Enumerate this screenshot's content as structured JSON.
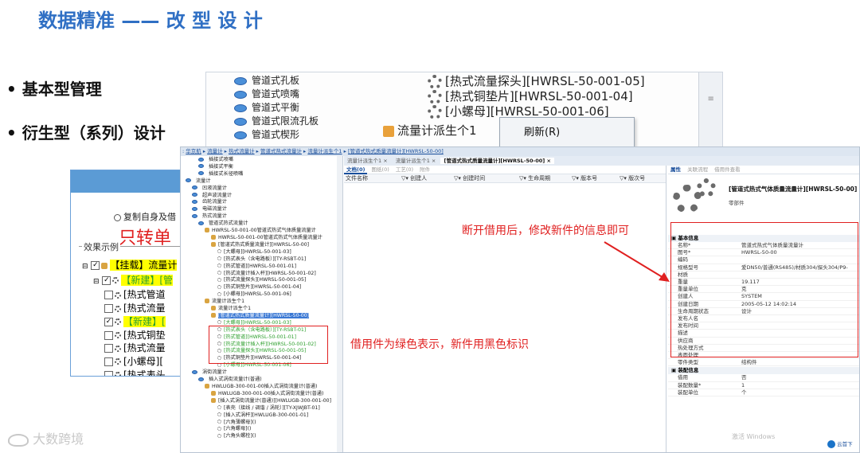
{
  "slide": {
    "title": "数据精准 —— 改 型 设 计",
    "bullets": [
      "基本型管理",
      "衍生型（系列）设计"
    ],
    "note_disconnect": "断开借用后，修改新件的信息即可",
    "note_color": "借用件为绿色表示，新件用黑色标识",
    "watermark": "大数跨境",
    "colors": {
      "title": "#2f6fc4",
      "accent_red": "#e02020",
      "green": "#2ea02e"
    }
  },
  "back_window": {
    "left_items": [
      "管道式孔板",
      "管道式喷嘴",
      "管道式平衡",
      "管道式限流孔板",
      "管道式楔形"
    ],
    "right_items": [
      "[热式流量探头][HWRSL-50-001-05]",
      "[热式铜垫片][HWRSL-50-001-04]",
      "[小螺母][HWRSL-50-001-06]"
    ],
    "derive_node": "流量计派生个1",
    "context_menu": "刷新(R)"
  },
  "dialog": {
    "radio_label": "复制自身及借",
    "big_label": "只转单",
    "group_title": "效果示例",
    "rows": [
      {
        "text": "【挂载】流量计",
        "hl": "yellow"
      },
      {
        "text": "【新建】[管",
        "hl": "yellow",
        "green_text": true
      },
      {
        "text": "[热式管道",
        "hl": ""
      },
      {
        "text": "[热式流量",
        "hl": ""
      },
      {
        "text": "【新建】[",
        "hl": "yellow",
        "green_text": true
      },
      {
        "text": "[热式铜垫",
        "hl": ""
      },
      {
        "text": "[热式流量",
        "hl": ""
      },
      {
        "text": "[小螺母][",
        "hl": ""
      },
      {
        "text": "[热式表头",
        "hl": ""
      }
    ]
  },
  "main_window": {
    "breadcrumb": [
      "华京航",
      "流量计",
      "热式流量计",
      "管道式热式流量计",
      "流量计派生个1",
      "[管道式热式质量流量计][HWRSL-50-00]"
    ],
    "tree": [
      {
        "t": "插接式喷嘴",
        "lv": 2
      },
      {
        "t": "插接式平衡",
        "lv": 2
      },
      {
        "t": "插接式长径喷嘴",
        "lv": 2
      },
      {
        "t": "流量计",
        "lv": 0
      },
      {
        "t": "凹液流量计",
        "lv": 1
      },
      {
        "t": "超声波流量计",
        "lv": 1
      },
      {
        "t": "齿轮流量计",
        "lv": 1
      },
      {
        "t": "电磁流量计",
        "lv": 1
      },
      {
        "t": "热式流量计",
        "lv": 1
      },
      {
        "t": "管道式热式流量计",
        "lv": 2
      },
      {
        "t": "HWRSL-50-001-00管道式热式气体质量流量计",
        "lv": 3
      },
      {
        "t": "HWRSL-50-001-00管道式热式气体质量流量计",
        "lv": 4
      },
      {
        "t": "[管道式热式质量流量计][HWRSL-50-00]",
        "lv": 4
      },
      {
        "t": "[大螺母][HWRSL-50-001-03]",
        "lv": 5
      },
      {
        "t": "[热式表头（含电路板）][TY-RSBT-01]",
        "lv": 5
      },
      {
        "t": "[热式管道][HWRSL-50-001-01]",
        "lv": 5
      },
      {
        "t": "[热式流量计插入杆][HWRSL-50-001-02]",
        "lv": 5
      },
      {
        "t": "[热式流量探头][HWRSL-50-001-05]",
        "lv": 5
      },
      {
        "t": "[热式铜垫片][HWRSL-50-001-04]",
        "lv": 5
      },
      {
        "t": "[小螺母][HWRSL-50-001-06]",
        "lv": 5
      },
      {
        "t": "流量计派生个1",
        "lv": 3
      },
      {
        "t": "流量计派生个1",
        "lv": 4
      },
      {
        "t": "[管道式热式质量流量计][HWRSL-50-00]",
        "lv": 4,
        "sel": true
      },
      {
        "t": "[大螺母][HWRSL-50-001-03]",
        "lv": 5,
        "g": true
      },
      {
        "t": "[热式表头（含电路板）][TY-RSBT-01]",
        "lv": 5,
        "g": true
      },
      {
        "t": "[热式管道][HWRSL-50-001-01]",
        "lv": 5,
        "g": true
      },
      {
        "t": "[热式流量计插入杆][HWRSL-50-001-02]",
        "lv": 5,
        "g": true
      },
      {
        "t": "[热式流量探头][HWRSL-50-001-05]",
        "lv": 5,
        "g": true
      },
      {
        "t": "[热式铜垫片][HWRSL-50-001-04]",
        "lv": 5
      },
      {
        "t": "[小螺母][HWRSL-50-001-06]",
        "lv": 5,
        "g": true
      },
      {
        "t": "涡街流量计",
        "lv": 1
      },
      {
        "t": "插入式涡街流量计(普通)",
        "lv": 2
      },
      {
        "t": "HWLUGB-300-001-00插入式涡街流量计(普通)",
        "lv": 3
      },
      {
        "t": "HWLUGB-300-001-00插入式涡街流量计(普通)",
        "lv": 4
      },
      {
        "t": "[插入式涡街流量计(普通)][HWLUGB-300-001-00]",
        "lv": 4
      },
      {
        "t": "[表壳（接线 / 调谐 / 涡轮）][TY-XJWJBT-01]",
        "lv": 5
      },
      {
        "t": "[插入式涡杆][HWLUGB-300-001-01]",
        "lv": 5
      },
      {
        "t": "[六角薄螺母]()",
        "lv": 5
      },
      {
        "t": "[六角螺母]()",
        "lv": 5
      },
      {
        "t": "[六角头螺栓]()",
        "lv": 5
      }
    ],
    "doc_tabs": [
      "流量计派生个1 ×",
      "流量计派生个1 ×",
      "[管道式热式质量流量计][HWRSL-50-00] ×"
    ],
    "sub_tabs": [
      "文档(0)",
      "图纸(0)",
      "工艺(0)",
      "附件"
    ],
    "columns": [
      "文件名称",
      "创建人",
      "创建时间",
      "生命周期",
      "版本号",
      "版次号"
    ],
    "prop_tabs": [
      "属性",
      "关联流程",
      "借用件查看"
    ],
    "prop_title": "[管道式热式气体质量流量计][HWRSL-50-00]",
    "prop_subtitle": "零部件",
    "basic_header": "基本信息",
    "props": [
      {
        "k": "名称*",
        "v": "管道式热式气体质量流量计"
      },
      {
        "k": "图号*",
        "v": "HWRSL-50-00"
      },
      {
        "k": "编码",
        "v": ""
      },
      {
        "k": "规格型号",
        "v": "爱DN50/普通(RS485)/材质304/探头304/P9-"
      },
      {
        "k": "材质",
        "v": ""
      },
      {
        "k": "重量",
        "v": "19.117"
      },
      {
        "k": "重量单位",
        "v": "克"
      },
      {
        "k": "创建人",
        "v": "SYSTEM"
      },
      {
        "k": "创建日期",
        "v": "2005-05-12 14:02:14"
      },
      {
        "k": "生命周期状态",
        "v": "设计"
      },
      {
        "k": "发布人名",
        "v": ""
      },
      {
        "k": "发布时间",
        "v": ""
      },
      {
        "k": "描述",
        "v": ""
      },
      {
        "k": "供应商",
        "v": ""
      },
      {
        "k": "热处理方式",
        "v": ""
      },
      {
        "k": "表面处理",
        "v": ""
      },
      {
        "k": "零件类型",
        "v": "结构件"
      }
    ],
    "assembly_header": "装配信息",
    "assembly_props": [
      {
        "k": "借用",
        "v": "否"
      },
      {
        "k": "装配数量*",
        "v": "1"
      },
      {
        "k": "装配单位",
        "v": "个"
      }
    ],
    "activate_text": "激活 Windows",
    "cloud_text": "云首下"
  }
}
